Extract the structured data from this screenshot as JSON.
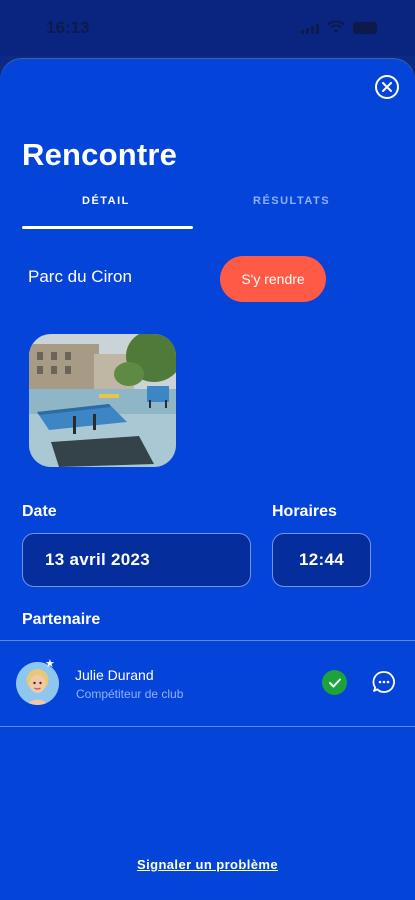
{
  "status_bar": {
    "time": "16:13"
  },
  "sheet": {
    "title": "Rencontre",
    "tabs": [
      {
        "label": "DÉTAIL",
        "active": true
      },
      {
        "label": "RÉSULTATS",
        "active": false
      }
    ],
    "location": {
      "name": "Parc du Ciron",
      "directions_label": "S'y rendre"
    },
    "date": {
      "label": "Date",
      "value": "13 avril 2023"
    },
    "hours": {
      "label": "Horaires",
      "value": "12:44"
    },
    "partner": {
      "section_label": "Partenaire",
      "name": "Julie Durand",
      "role": "Compétiteur de club"
    },
    "report_label": "Signaler un problème"
  },
  "colors": {
    "sheet_background": "#0544d8",
    "accent_button": "#ff5a46",
    "field_background": "#062d9c",
    "success": "#1ea23b"
  },
  "icons": [
    "close-icon",
    "star-icon",
    "check-icon",
    "chat-icon"
  ]
}
